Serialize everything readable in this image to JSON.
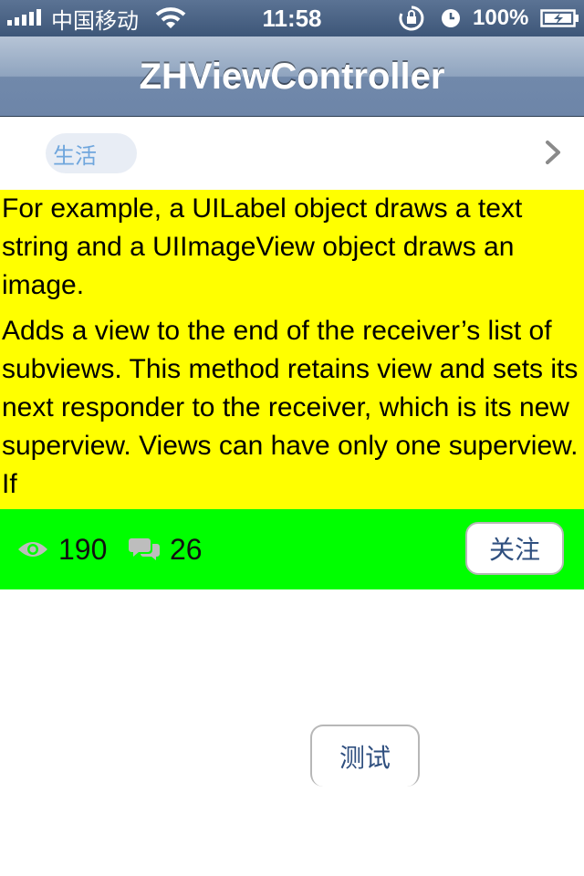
{
  "status_bar": {
    "carrier": "中国移动",
    "time": "11:58",
    "battery": "100%",
    "icons": [
      "signal-icon",
      "wifi-icon",
      "rotation-lock-icon",
      "alarm-clock-icon",
      "battery-icon"
    ]
  },
  "nav": {
    "title": "ZHViewController"
  },
  "tag": {
    "label": "生活"
  },
  "content": {
    "paragraph_1": "For example, a UILabel object draws a text string and a UIImageView object draws an image.",
    "paragraph_2": "Adds a view to the end of the receiver’s list of subviews. This method retains view and sets its next responder to the receiver, which is its new superview. Views can have only one superview. If"
  },
  "stats": {
    "views": "190",
    "comments": "26"
  },
  "buttons": {
    "follow": "关注",
    "test": "测试"
  },
  "colors": {
    "content_bg": "#ffff00",
    "action_bar_bg": "#00ff00",
    "tag_text": "#6fa6dd",
    "button_text": "#2f4f7f"
  }
}
